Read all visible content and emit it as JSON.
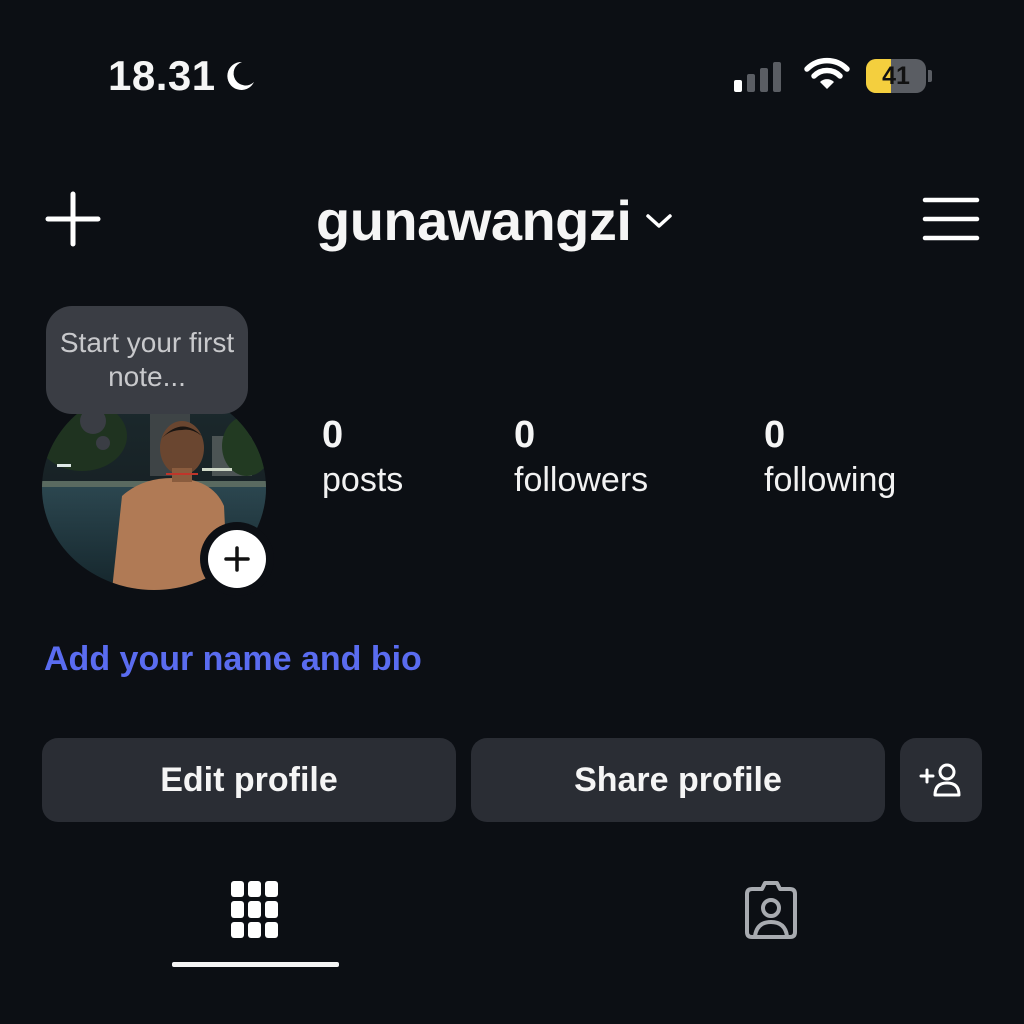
{
  "status_bar": {
    "time": "18.31",
    "battery_percent": "41",
    "battery_level": 0.41,
    "signal_bars_active": 1,
    "signal_bars_total": 4,
    "battery_color": "#f4cf3e"
  },
  "header": {
    "username": "gunawangzi",
    "icons": [
      "plus-icon",
      "chevron-down-icon",
      "hamburger-menu-icon"
    ]
  },
  "note": {
    "text": "Start your first note..."
  },
  "stats": {
    "posts": {
      "count": "0",
      "label": "posts"
    },
    "followers": {
      "count": "0",
      "label": "followers"
    },
    "following": {
      "count": "0",
      "label": "following"
    }
  },
  "bio": {
    "link_text": "Add your name and bio",
    "link_color": "#5a6cf0"
  },
  "actions": {
    "edit_profile": "Edit profile",
    "share_profile": "Share profile"
  },
  "tabs": {
    "active": "grid",
    "items": [
      "grid-icon",
      "tagged-person-icon"
    ]
  }
}
